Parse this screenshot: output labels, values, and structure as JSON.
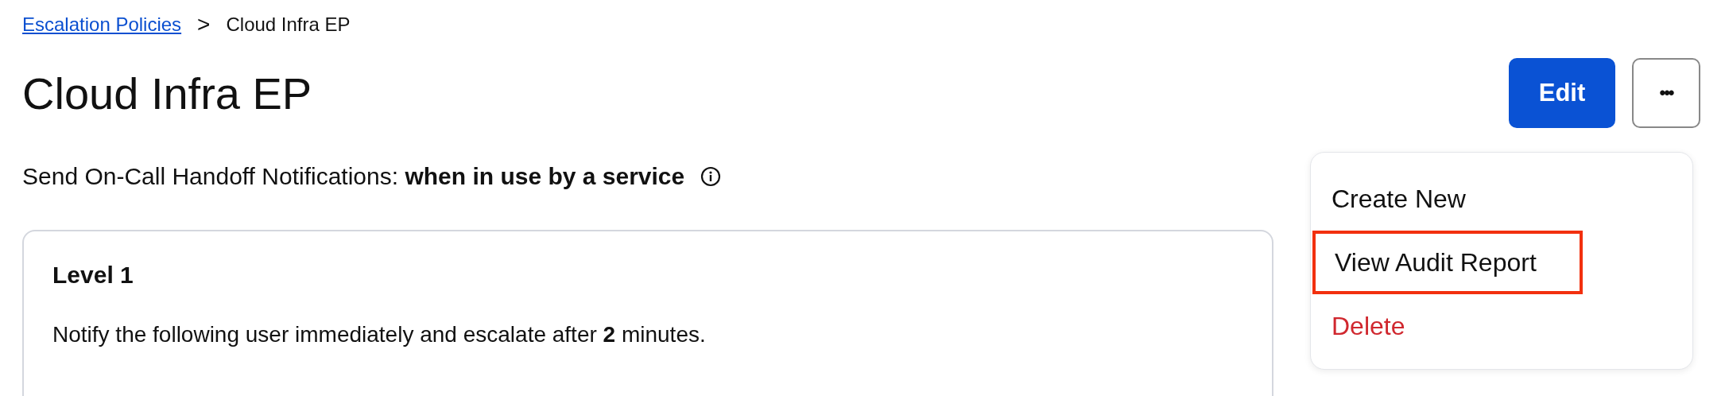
{
  "breadcrumb": {
    "link": "Escalation Policies",
    "separator": ">",
    "current": "Cloud Infra EP"
  },
  "title": "Cloud Infra EP",
  "actions": {
    "edit": "Edit",
    "more": "•••"
  },
  "menu": {
    "items": [
      {
        "label": "Create New",
        "kind": "normal",
        "highlighted": false
      },
      {
        "label": "View Audit Report",
        "kind": "normal",
        "highlighted": true
      },
      {
        "label": "Delete",
        "kind": "danger",
        "highlighted": false
      }
    ]
  },
  "handoff": {
    "text": "Send On-Call Handoff Notifications: **when in use by a service**"
  },
  "levels": [
    {
      "title": "Level 1",
      "text": "Notify the following user immediately and escalate after **2** minutes."
    }
  ]
}
